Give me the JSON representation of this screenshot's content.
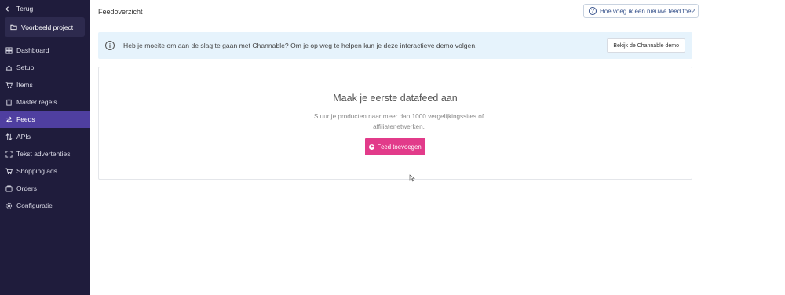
{
  "sidebar": {
    "back_label": "Terug",
    "project_label": "Voorbeeld project",
    "items": [
      {
        "label": "Dashboard",
        "icon": "dashboard-icon"
      },
      {
        "label": "Setup",
        "icon": "setup-icon"
      },
      {
        "label": "Items",
        "icon": "cart-icon"
      },
      {
        "label": "Master regels",
        "icon": "clipboard-icon"
      },
      {
        "label": "Feeds",
        "icon": "feeds-icon",
        "active": true
      },
      {
        "label": "APIs",
        "icon": "sort-icon"
      },
      {
        "label": "Tekst advertenties",
        "icon": "expand-icon"
      },
      {
        "label": "Shopping ads",
        "icon": "cart-icon"
      },
      {
        "label": "Orders",
        "icon": "orders-icon"
      },
      {
        "label": "Configuratie",
        "icon": "gear-icon"
      }
    ]
  },
  "header": {
    "title": "Feedoverzicht",
    "help_label": "Hoe voeg ik een nieuwe feed toe?"
  },
  "banner": {
    "text": "Heb je moeite om aan de slag te gaan met Channable? Om je op weg te helpen kun je deze interactieve demo volgen.",
    "button_label": "Bekijk de Channable demo"
  },
  "empty_state": {
    "title": "Maak je eerste datafeed aan",
    "subtitle": "Stuur je producten naar meer dan 1000 vergelijkingssites of affiliatenetwerken.",
    "button_label": "Feed toevoegen"
  },
  "colors": {
    "sidebar_bg": "#1f1c3c",
    "active_item": "#4f3fa0",
    "banner_bg": "#e6f3fc",
    "primary_button": "#e23b8a"
  }
}
